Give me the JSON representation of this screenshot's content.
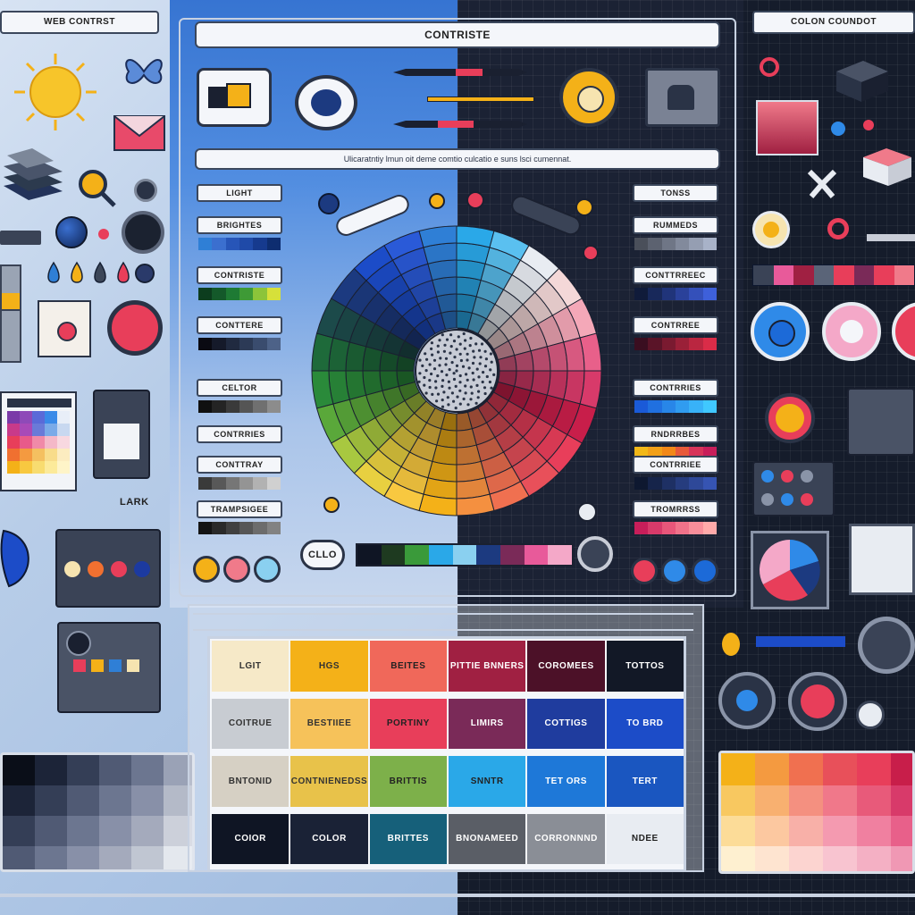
{
  "left_panel": {
    "title": "WEB CONTRST",
    "caption_lark": "LARK"
  },
  "center_panel": {
    "title": "CONTRISTE",
    "subtitle": "Ulicaratntiy lmun oit deme comtio culcatio e suns lsci cumennat.",
    "left_labels": [
      {
        "text": "LIGHT",
        "colors": []
      },
      {
        "text": "BRIGHTES",
        "colors": [
          "#2f7fd6",
          "#3b6fcf",
          "#2755b8",
          "#1f4aa8",
          "#163a8e",
          "#0e2d70"
        ]
      },
      {
        "text": "CONTRISTE",
        "colors": [
          "#0c3d1e",
          "#14592a",
          "#1e7a34",
          "#3e9a36",
          "#8cc43a",
          "#d6e03a"
        ]
      },
      {
        "text": "CONTTERE",
        "colors": [
          "#0a0a12",
          "#151a2a",
          "#202a40",
          "#2c3a56",
          "#3a4c6e",
          "#4d6288"
        ]
      },
      {
        "text": "CELTOR",
        "colors": [
          "#101010",
          "#242424",
          "#3a3a3a",
          "#555",
          "#707070",
          "#8c8c8c"
        ]
      },
      {
        "text": "CONTRRIES",
        "colors": []
      },
      {
        "text": "CONTTRAY",
        "colors": [
          "#3a3a3a",
          "#585858",
          "#767676",
          "#949494",
          "#b2b2b2",
          "#d0d0d0"
        ]
      },
      {
        "text": "TRAMPSIGEE",
        "colors": [
          "#141414",
          "#2a2a2a",
          "#404040",
          "#565656",
          "#6c6c6c",
          "#828282"
        ]
      }
    ],
    "right_labels": [
      {
        "text": "TONSS",
        "colors": []
      },
      {
        "text": "RUMMEDS",
        "colors": [
          "#4a4f5a",
          "#5c6270",
          "#6f7686",
          "#828a9c",
          "#959eb2",
          "#a8b2c8"
        ]
      },
      {
        "text": "CONTTRREEC",
        "colors": [
          "#101b3a",
          "#18285a",
          "#20347a",
          "#2a419a",
          "#3450ba",
          "#3e60da"
        ]
      },
      {
        "text": "CONTRREE",
        "colors": [
          "#3a0e20",
          "#5a1428",
          "#7a1a30",
          "#9a2038",
          "#ba2640",
          "#da2c48"
        ]
      },
      {
        "text": "CONTRRIES",
        "colors": [
          "#1a5ad8",
          "#2070e0",
          "#2886e8",
          "#309cf0",
          "#38b2f8",
          "#40c8ff"
        ]
      },
      {
        "text": "RNDRRBES",
        "colors": [
          "#f2b818",
          "#f2a018",
          "#f28818",
          "#e85a3a",
          "#d8345a",
          "#c81e5a"
        ]
      },
      {
        "text": "CONTRRIEE",
        "colors": [
          "#0e1830",
          "#16244a",
          "#1e3064",
          "#263c7e",
          "#2e4898",
          "#3654b2"
        ]
      },
      {
        "text": "TROMRRSS",
        "colors": [
          "#c81e5a",
          "#d83a6a",
          "#e8567a",
          "#f0728a",
          "#f88e9a",
          "#ffaaaa"
        ]
      }
    ],
    "bottom_pill": "CLLO"
  },
  "right_panel": {
    "title": "COLON COUNDOT"
  },
  "table": {
    "rows": [
      [
        {
          "text": "LGIT",
          "bg": "#f6e9c8",
          "fg": "#333"
        },
        {
          "text": "HGS",
          "bg": "#f4b118",
          "fg": "#333"
        },
        {
          "text": "BEITES",
          "bg": "#f0685a",
          "fg": "#222"
        },
        {
          "text": "PITTIE BNNERS",
          "bg": "#a02042",
          "fg": "#fff"
        },
        {
          "text": "COROMEES",
          "bg": "#4c1128",
          "fg": "#fff"
        },
        {
          "text": "TOTTOS",
          "bg": "#121826",
          "fg": "#fff"
        }
      ],
      [
        {
          "text": "COITRUE",
          "bg": "#c8ccd2",
          "fg": "#333"
        },
        {
          "text": "BESTIIEE",
          "bg": "#f6c25a",
          "fg": "#333"
        },
        {
          "text": "PORTINY",
          "bg": "#e83e5a",
          "fg": "#222"
        },
        {
          "text": "LIMIRS",
          "bg": "#7a2a58",
          "fg": "#fff"
        },
        {
          "text": "COTTIGS",
          "bg": "#1f3c9e",
          "fg": "#fff"
        },
        {
          "text": "TO BRD",
          "bg": "#1c4cc8",
          "fg": "#fff"
        }
      ],
      [
        {
          "text": "BNTONID",
          "bg": "#d6d0c4",
          "fg": "#333"
        },
        {
          "text": "CONTNIENEDSS",
          "bg": "#e8c24a",
          "fg": "#333"
        },
        {
          "text": "BRITTIS",
          "bg": "#7db04a",
          "fg": "#222"
        },
        {
          "text": "SNNTR",
          "bg": "#2aa8e8",
          "fg": "#222"
        },
        {
          "text": "TET ORS",
          "bg": "#1e78d8",
          "fg": "#fff"
        },
        {
          "text": "TERT",
          "bg": "#1a56c0",
          "fg": "#fff"
        }
      ],
      [
        {
          "text": "COIOR",
          "bg": "#0f1524",
          "fg": "#fff"
        },
        {
          "text": "COLOR",
          "bg": "#1a2236",
          "fg": "#fff"
        },
        {
          "text": "BRITTES",
          "bg": "#16607a",
          "fg": "#fff"
        },
        {
          "text": "BNONAMEED",
          "bg": "#5a5e66",
          "fg": "#fff"
        },
        {
          "text": "CORRONNND",
          "bg": "#8a8e96",
          "fg": "#fff"
        },
        {
          "text": "NDEE",
          "bg": "#e8ecf2",
          "fg": "#222"
        }
      ]
    ]
  },
  "colors": {
    "accent_yellow": "#f4b118",
    "accent_pink": "#e83e5a",
    "accent_blue": "#2f7fd6",
    "dark_bg": "#151c2b",
    "light_bg": "#bcd0ea"
  },
  "icons": [
    "sun-icon",
    "butterfly-icon",
    "envelope-icon",
    "magnifier-icon",
    "globe-icon",
    "pen-icon",
    "lock-icon",
    "pie-chart-icon",
    "gear-icon",
    "monitor-icon"
  ]
}
